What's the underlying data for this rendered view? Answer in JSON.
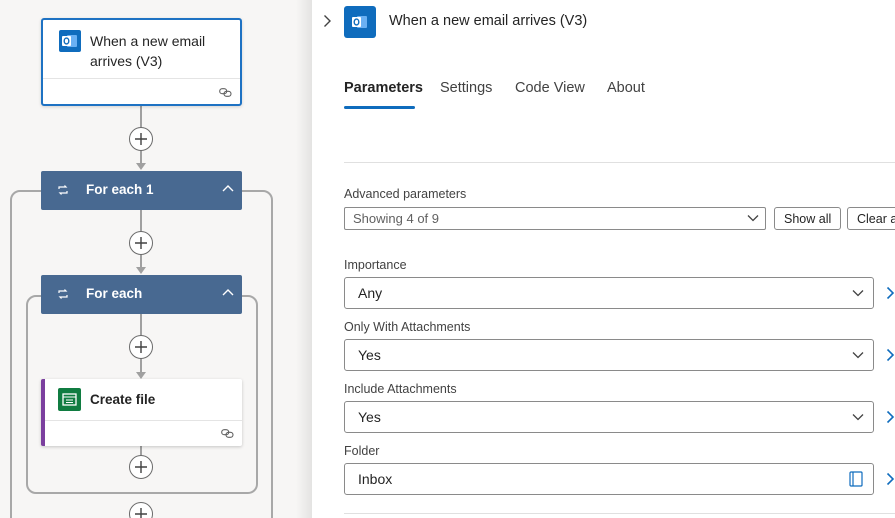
{
  "canvas": {
    "trigger": {
      "title": "When a new email arrives (V3)",
      "icon": "outlook-icon"
    },
    "loops": [
      {
        "title": "For each 1",
        "icon": "loop-icon"
      },
      {
        "title": "For each",
        "icon": "loop-icon"
      }
    ],
    "action": {
      "title": "Create file",
      "icon": "onedrive-file-icon"
    }
  },
  "panel": {
    "title": "When a new email arrives (V3)",
    "icon": "outlook-icon",
    "tabs": [
      {
        "label": "Parameters",
        "active": true
      },
      {
        "label": "Settings",
        "active": false
      },
      {
        "label": "Code View",
        "active": false
      },
      {
        "label": "About",
        "active": false
      }
    ],
    "advanced": {
      "label": "Advanced parameters",
      "value": "Showing 4 of 9",
      "show_all": "Show all",
      "clear_all": "Clear all"
    },
    "fields": [
      {
        "label": "Importance",
        "value": "Any",
        "type": "dropdown"
      },
      {
        "label": "Only With Attachments",
        "value": "Yes",
        "type": "dropdown"
      },
      {
        "label": "Include Attachments",
        "value": "Yes",
        "type": "dropdown"
      },
      {
        "label": "Folder",
        "value": "Inbox",
        "type": "picker"
      }
    ]
  },
  "colors": {
    "accent": "#0f6cbd",
    "loop_header": "#486991",
    "action_border": "#7b3f9e",
    "file_icon": "#107c41",
    "canvas_bg": "#f7f6f5"
  }
}
